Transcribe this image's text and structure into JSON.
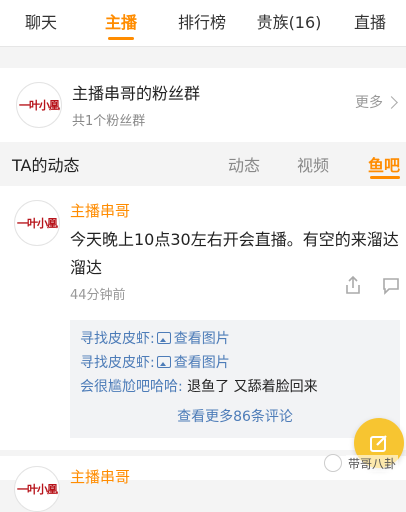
{
  "tabs": [
    {
      "label": "聊天",
      "active": false
    },
    {
      "label": "主播",
      "active": true
    },
    {
      "label": "排行榜",
      "active": false
    },
    {
      "label": "贵族(16)",
      "active": false
    },
    {
      "label": "直播",
      "active": false
    }
  ],
  "fans_group": {
    "logo_text": "一叶小凰",
    "title": "主播串哥的粉丝群",
    "subtitle": "共1个粉丝群",
    "more_label": "更多"
  },
  "dynamics": {
    "title": "TA的动态",
    "tabs": [
      {
        "label": "动态",
        "active": false
      },
      {
        "label": "视频",
        "active": false
      },
      {
        "label": "鱼吧",
        "active": true
      }
    ]
  },
  "post": {
    "author": "主播串哥",
    "content": "今天晚上10点30左右开会直播。有空的来溜达溜达",
    "time": "44分钟前",
    "comments": [
      {
        "name": "寻找皮皮虾:",
        "link": "查看图片",
        "text": ""
      },
      {
        "name": "寻找皮皮虾:",
        "link": "查看图片",
        "text": ""
      },
      {
        "name": "会很尴尬吧哈哈:",
        "link": "",
        "text": "退鱼了 又舔着脸回来"
      }
    ],
    "more_comments": "查看更多86条评论"
  },
  "post2": {
    "author": "主播串哥"
  },
  "watermark": "带哥八卦",
  "colors": {
    "accent": "#ff8c00",
    "link": "#4d7cb8",
    "fab": "#f7c531"
  }
}
